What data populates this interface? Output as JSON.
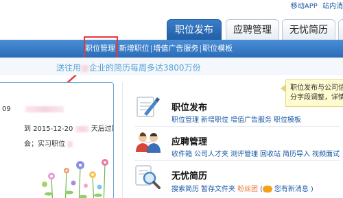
{
  "top": {
    "links": [
      "移动APP",
      "站内消"
    ]
  },
  "tabs": [
    {
      "label": "职位发布",
      "active": true
    },
    {
      "label": "应聘管理",
      "active": false
    },
    {
      "label": "无忧简历",
      "active": false
    }
  ],
  "nav": {
    "items": [
      "职位管理",
      "新增职位",
      "增值广告服务",
      "职位模板"
    ],
    "separator": "|"
  },
  "banner": {
    "prefix": "送往用",
    "middle": "企业的简历每周多达",
    "number": "3800万份"
  },
  "left_card": {
    "num": "09",
    "line2_prefix": "到",
    "date": "2015-12-20",
    "after_date": "天后过期",
    "line3": "会；实习职位"
  },
  "tooltip": {
    "line1": "职位发布与公司信",
    "line2": "分字段调整，详情"
  },
  "sections": [
    {
      "title": "职位发布",
      "links": [
        "职位管理",
        "新增职位",
        "增值广告服务",
        "职位模板"
      ]
    },
    {
      "title": "应聘管理",
      "links": [
        "收件箱",
        "公司人才夹",
        "测评管理",
        "回收站",
        "简历导入",
        "视频面试"
      ]
    },
    {
      "title": "无忧简历",
      "links": [
        "搜索简历",
        "暂存文件夹"
      ],
      "extra_link": "粉丝团",
      "message": "您有新消息"
    }
  ],
  "colors": {
    "primary": "#2b6cb8",
    "link": "#1a5aa8",
    "highlight": "#ee3333",
    "banner_text": "#56a0d6"
  }
}
